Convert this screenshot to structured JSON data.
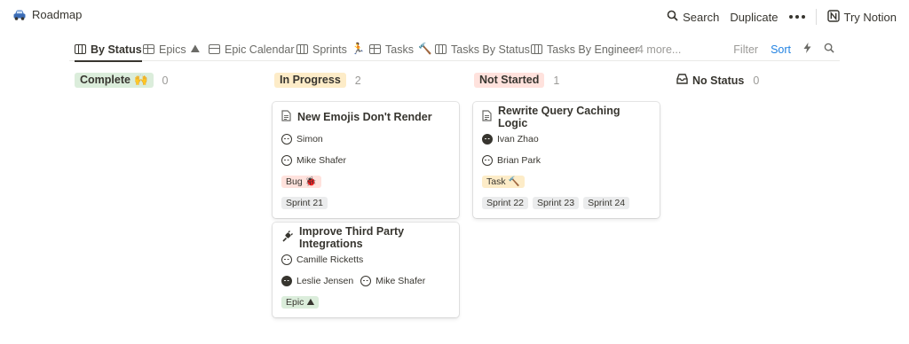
{
  "breadcrumb": {
    "title": "Roadmap",
    "icon": "car-icon"
  },
  "top_actions": {
    "search": "Search",
    "duplicate": "Duplicate",
    "try": "Try Notion"
  },
  "views": [
    {
      "label": "By Status",
      "icon": "board-icon",
      "emoji": ""
    },
    {
      "label": "Epics",
      "icon": "table-icon",
      "emoji": "⛰"
    },
    {
      "label": "Epic Calendar",
      "icon": "calendar-icon",
      "emoji": ""
    },
    {
      "label": "Sprints",
      "icon": "board-icon",
      "emoji": "🏃"
    },
    {
      "label": "Tasks",
      "icon": "table-icon",
      "emoji": "🔨"
    },
    {
      "label": "Tasks By Status",
      "icon": "board-icon",
      "emoji": ""
    },
    {
      "label": "Tasks By Engineer",
      "icon": "board-icon",
      "emoji": ""
    }
  ],
  "more_views": "4 more...",
  "tools": {
    "filter": "Filter",
    "sort": "Sort"
  },
  "columns": [
    {
      "label": "Complete",
      "emoji": "🙌",
      "count": "0",
      "color": "#dbeddb"
    },
    {
      "label": "In Progress",
      "emoji": "",
      "count": "2",
      "color": "#fdecc8"
    },
    {
      "label": "Not Started",
      "emoji": "",
      "count": "1",
      "color": "#ffe2dd"
    },
    {
      "label": "No Status",
      "emoji": "",
      "count": "0",
      "color": ""
    }
  ],
  "cards": [
    {
      "title": "New Emojis Don't Render",
      "icon": "page-icon",
      "people": [
        [
          "Simon"
        ],
        [
          "Mike Shafer"
        ]
      ],
      "type": {
        "label": "Bug",
        "emoji": "🐞",
        "color": "#ffe2dd"
      },
      "sprints": [
        "Sprint 21"
      ]
    },
    {
      "title": "Improve Third Party Integrations",
      "icon": "plug-icon",
      "people": [
        [
          "Camille Ricketts"
        ],
        [
          "Leslie Jensen",
          "Mike Shafer"
        ]
      ],
      "type": {
        "label": "Epic",
        "emoji": "⛰",
        "color": "#dbeddb"
      },
      "sprints": []
    },
    {
      "title": "Rewrite Query Caching Logic",
      "icon": "page-icon",
      "people": [
        [
          "Ivan Zhao"
        ],
        [
          "Brian Park"
        ]
      ],
      "type": {
        "label": "Task",
        "emoji": "🔨",
        "color": "#fdecc8"
      },
      "sprints": [
        "Sprint 22",
        "Sprint 23",
        "Sprint 24"
      ]
    }
  ]
}
